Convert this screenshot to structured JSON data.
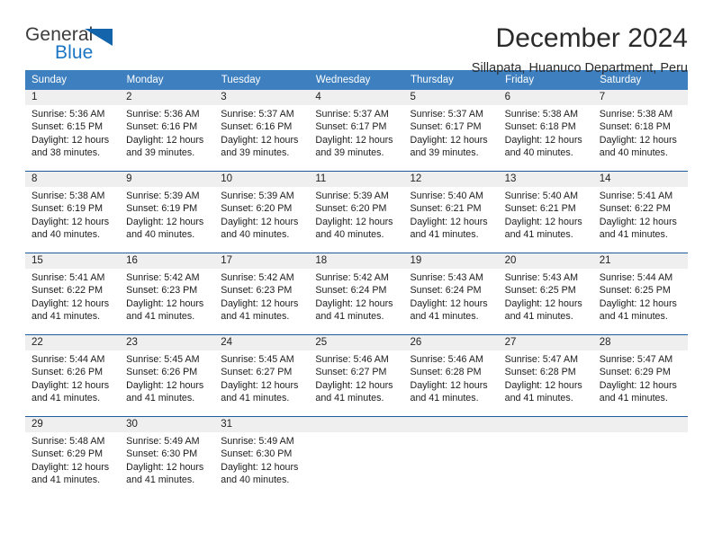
{
  "logo": {
    "word_one": "General",
    "word_two": "Blue",
    "triangle_icon": "triangle-icon"
  },
  "header": {
    "title": "December 2024",
    "subtitle": "Sillapata, Huanuco Department, Peru"
  },
  "colors": {
    "header_blue": "#3d7fbf",
    "row_divider_blue": "#1f5c9e",
    "daynum_strip_gray": "#efefef",
    "logo_blue": "#1a76c4",
    "logo_triangle_blue": "#1364ab",
    "text": "#1c1c1c"
  },
  "weekdays": [
    "Sunday",
    "Monday",
    "Tuesday",
    "Wednesday",
    "Thursday",
    "Friday",
    "Saturday"
  ],
  "weeks": [
    [
      {
        "day": "1",
        "sunrise": "Sunrise: 5:36 AM",
        "sunset": "Sunset: 6:15 PM",
        "daylight_line1": "Daylight: 12 hours",
        "daylight_line2": "and 38 minutes."
      },
      {
        "day": "2",
        "sunrise": "Sunrise: 5:36 AM",
        "sunset": "Sunset: 6:16 PM",
        "daylight_line1": "Daylight: 12 hours",
        "daylight_line2": "and 39 minutes."
      },
      {
        "day": "3",
        "sunrise": "Sunrise: 5:37 AM",
        "sunset": "Sunset: 6:16 PM",
        "daylight_line1": "Daylight: 12 hours",
        "daylight_line2": "and 39 minutes."
      },
      {
        "day": "4",
        "sunrise": "Sunrise: 5:37 AM",
        "sunset": "Sunset: 6:17 PM",
        "daylight_line1": "Daylight: 12 hours",
        "daylight_line2": "and 39 minutes."
      },
      {
        "day": "5",
        "sunrise": "Sunrise: 5:37 AM",
        "sunset": "Sunset: 6:17 PM",
        "daylight_line1": "Daylight: 12 hours",
        "daylight_line2": "and 39 minutes."
      },
      {
        "day": "6",
        "sunrise": "Sunrise: 5:38 AM",
        "sunset": "Sunset: 6:18 PM",
        "daylight_line1": "Daylight: 12 hours",
        "daylight_line2": "and 40 minutes."
      },
      {
        "day": "7",
        "sunrise": "Sunrise: 5:38 AM",
        "sunset": "Sunset: 6:18 PM",
        "daylight_line1": "Daylight: 12 hours",
        "daylight_line2": "and 40 minutes."
      }
    ],
    [
      {
        "day": "8",
        "sunrise": "Sunrise: 5:38 AM",
        "sunset": "Sunset: 6:19 PM",
        "daylight_line1": "Daylight: 12 hours",
        "daylight_line2": "and 40 minutes."
      },
      {
        "day": "9",
        "sunrise": "Sunrise: 5:39 AM",
        "sunset": "Sunset: 6:19 PM",
        "daylight_line1": "Daylight: 12 hours",
        "daylight_line2": "and 40 minutes."
      },
      {
        "day": "10",
        "sunrise": "Sunrise: 5:39 AM",
        "sunset": "Sunset: 6:20 PM",
        "daylight_line1": "Daylight: 12 hours",
        "daylight_line2": "and 40 minutes."
      },
      {
        "day": "11",
        "sunrise": "Sunrise: 5:39 AM",
        "sunset": "Sunset: 6:20 PM",
        "daylight_line1": "Daylight: 12 hours",
        "daylight_line2": "and 40 minutes."
      },
      {
        "day": "12",
        "sunrise": "Sunrise: 5:40 AM",
        "sunset": "Sunset: 6:21 PM",
        "daylight_line1": "Daylight: 12 hours",
        "daylight_line2": "and 41 minutes."
      },
      {
        "day": "13",
        "sunrise": "Sunrise: 5:40 AM",
        "sunset": "Sunset: 6:21 PM",
        "daylight_line1": "Daylight: 12 hours",
        "daylight_line2": "and 41 minutes."
      },
      {
        "day": "14",
        "sunrise": "Sunrise: 5:41 AM",
        "sunset": "Sunset: 6:22 PM",
        "daylight_line1": "Daylight: 12 hours",
        "daylight_line2": "and 41 minutes."
      }
    ],
    [
      {
        "day": "15",
        "sunrise": "Sunrise: 5:41 AM",
        "sunset": "Sunset: 6:22 PM",
        "daylight_line1": "Daylight: 12 hours",
        "daylight_line2": "and 41 minutes."
      },
      {
        "day": "16",
        "sunrise": "Sunrise: 5:42 AM",
        "sunset": "Sunset: 6:23 PM",
        "daylight_line1": "Daylight: 12 hours",
        "daylight_line2": "and 41 minutes."
      },
      {
        "day": "17",
        "sunrise": "Sunrise: 5:42 AM",
        "sunset": "Sunset: 6:23 PM",
        "daylight_line1": "Daylight: 12 hours",
        "daylight_line2": "and 41 minutes."
      },
      {
        "day": "18",
        "sunrise": "Sunrise: 5:42 AM",
        "sunset": "Sunset: 6:24 PM",
        "daylight_line1": "Daylight: 12 hours",
        "daylight_line2": "and 41 minutes."
      },
      {
        "day": "19",
        "sunrise": "Sunrise: 5:43 AM",
        "sunset": "Sunset: 6:24 PM",
        "daylight_line1": "Daylight: 12 hours",
        "daylight_line2": "and 41 minutes."
      },
      {
        "day": "20",
        "sunrise": "Sunrise: 5:43 AM",
        "sunset": "Sunset: 6:25 PM",
        "daylight_line1": "Daylight: 12 hours",
        "daylight_line2": "and 41 minutes."
      },
      {
        "day": "21",
        "sunrise": "Sunrise: 5:44 AM",
        "sunset": "Sunset: 6:25 PM",
        "daylight_line1": "Daylight: 12 hours",
        "daylight_line2": "and 41 minutes."
      }
    ],
    [
      {
        "day": "22",
        "sunrise": "Sunrise: 5:44 AM",
        "sunset": "Sunset: 6:26 PM",
        "daylight_line1": "Daylight: 12 hours",
        "daylight_line2": "and 41 minutes."
      },
      {
        "day": "23",
        "sunrise": "Sunrise: 5:45 AM",
        "sunset": "Sunset: 6:26 PM",
        "daylight_line1": "Daylight: 12 hours",
        "daylight_line2": "and 41 minutes."
      },
      {
        "day": "24",
        "sunrise": "Sunrise: 5:45 AM",
        "sunset": "Sunset: 6:27 PM",
        "daylight_line1": "Daylight: 12 hours",
        "daylight_line2": "and 41 minutes."
      },
      {
        "day": "25",
        "sunrise": "Sunrise: 5:46 AM",
        "sunset": "Sunset: 6:27 PM",
        "daylight_line1": "Daylight: 12 hours",
        "daylight_line2": "and 41 minutes."
      },
      {
        "day": "26",
        "sunrise": "Sunrise: 5:46 AM",
        "sunset": "Sunset: 6:28 PM",
        "daylight_line1": "Daylight: 12 hours",
        "daylight_line2": "and 41 minutes."
      },
      {
        "day": "27",
        "sunrise": "Sunrise: 5:47 AM",
        "sunset": "Sunset: 6:28 PM",
        "daylight_line1": "Daylight: 12 hours",
        "daylight_line2": "and 41 minutes."
      },
      {
        "day": "28",
        "sunrise": "Sunrise: 5:47 AM",
        "sunset": "Sunset: 6:29 PM",
        "daylight_line1": "Daylight: 12 hours",
        "daylight_line2": "and 41 minutes."
      }
    ],
    [
      {
        "day": "29",
        "sunrise": "Sunrise: 5:48 AM",
        "sunset": "Sunset: 6:29 PM",
        "daylight_line1": "Daylight: 12 hours",
        "daylight_line2": "and 41 minutes."
      },
      {
        "day": "30",
        "sunrise": "Sunrise: 5:49 AM",
        "sunset": "Sunset: 6:30 PM",
        "daylight_line1": "Daylight: 12 hours",
        "daylight_line2": "and 41 minutes."
      },
      {
        "day": "31",
        "sunrise": "Sunrise: 5:49 AM",
        "sunset": "Sunset: 6:30 PM",
        "daylight_line1": "Daylight: 12 hours",
        "daylight_line2": "and 40 minutes."
      },
      {
        "day": "",
        "sunrise": "",
        "sunset": "",
        "daylight_line1": "",
        "daylight_line2": ""
      },
      {
        "day": "",
        "sunrise": "",
        "sunset": "",
        "daylight_line1": "",
        "daylight_line2": ""
      },
      {
        "day": "",
        "sunrise": "",
        "sunset": "",
        "daylight_line1": "",
        "daylight_line2": ""
      },
      {
        "day": "",
        "sunrise": "",
        "sunset": "",
        "daylight_line1": "",
        "daylight_line2": ""
      }
    ]
  ]
}
